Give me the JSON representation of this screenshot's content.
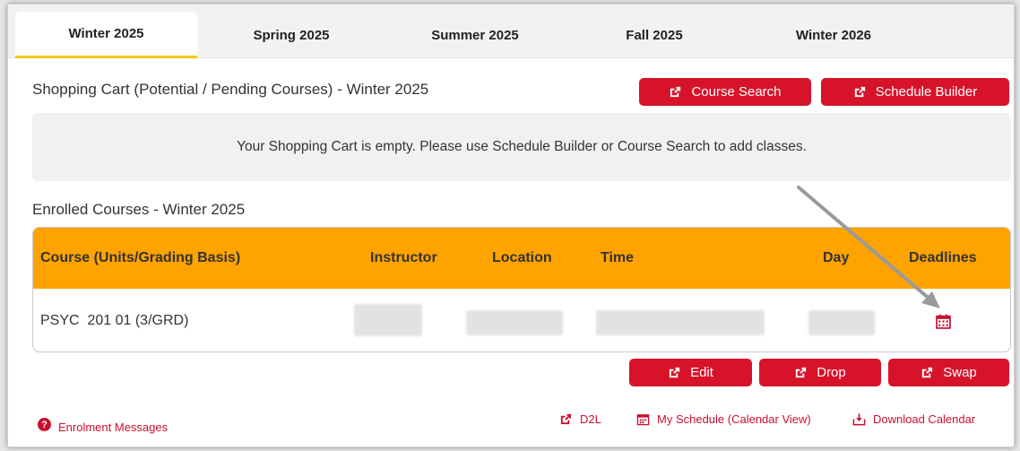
{
  "tabs": [
    {
      "label": "Winter 2025",
      "active": true
    },
    {
      "label": "Spring 2025",
      "active": false
    },
    {
      "label": "Summer 2025",
      "active": false
    },
    {
      "label": "Fall 2025",
      "active": false
    },
    {
      "label": "Winter 2026",
      "active": false
    }
  ],
  "cart": {
    "title": "Shopping Cart (Potential / Pending Courses) - Winter 2025",
    "course_search_label": "Course Search",
    "schedule_builder_label": "Schedule Builder",
    "empty_message": "Your Shopping Cart is empty. Please use Schedule Builder or Course Search to add classes."
  },
  "enrolled": {
    "title": "Enrolled Courses - Winter 2025",
    "columns": [
      "Course (Units/Grading Basis)",
      "Instructor",
      "Location",
      "Time",
      "Day",
      "Deadlines"
    ],
    "rows": [
      {
        "course": "PSYC  201 01 (3/GRD)",
        "deadline_icon": "calendar-icon"
      }
    ]
  },
  "actions": {
    "edit_label": "Edit",
    "drop_label": "Drop",
    "swap_label": "Swap"
  },
  "footer": {
    "enrolment_messages": "Enrolment Messages",
    "d2l": "D2L",
    "my_schedule": "My Schedule (Calendar View)",
    "download_calendar": "Download Calendar"
  },
  "colors": {
    "brand_red": "#d7132a",
    "header_orange": "#ffa300",
    "active_tab_underline": "#f5c518"
  }
}
